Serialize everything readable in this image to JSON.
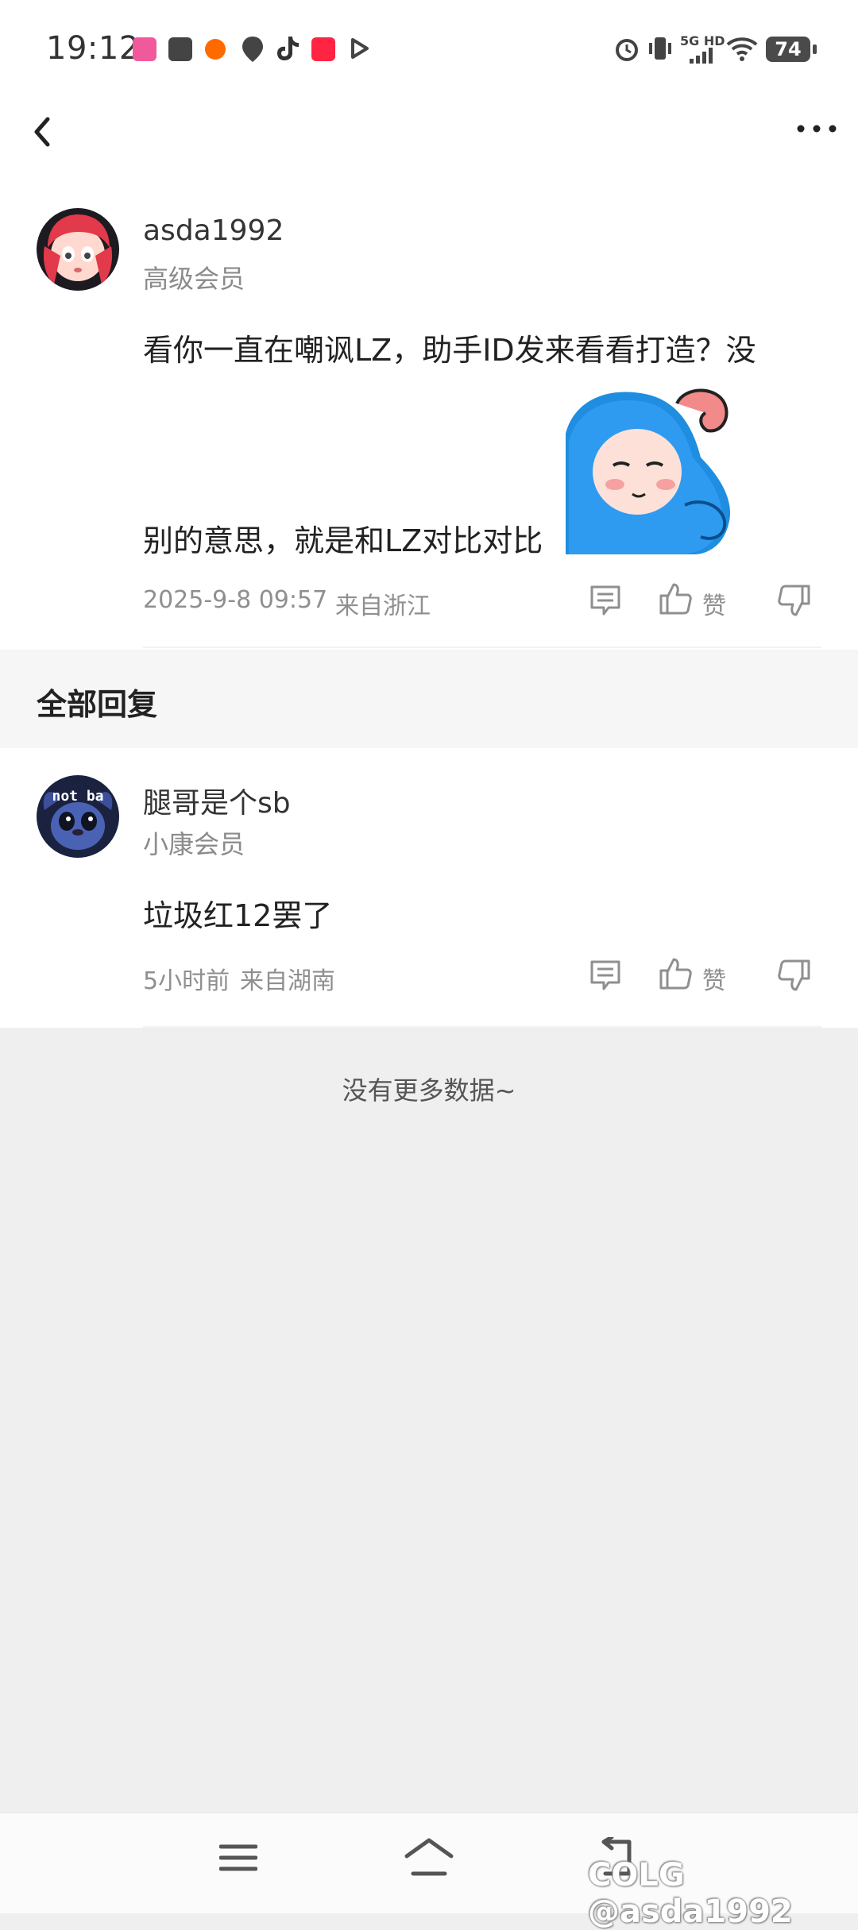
{
  "status_bar": {
    "time": "19:12",
    "network": "5G HD",
    "battery": "74",
    "app_icons": [
      "lofter-icon",
      "mail-icon",
      "taobao-icon",
      "du-icon",
      "tiktok-icon",
      "xiaohongshu-icon",
      "play-icon"
    ]
  },
  "top_bar": {
    "back_icon": "chevron-left-icon",
    "more_icon": "more-dots-icon"
  },
  "post": {
    "username": "asda1992",
    "member_level": "高级会员",
    "content_line1": "看你一直在嘲讽LZ，助手ID发来看看打造？没",
    "content_line2": "别的意思，就是和LZ对比对比",
    "sticker": "blue-character-sticker",
    "timestamp": "2025-9-8 09:57",
    "location": "来自浙江",
    "like_label": "赞"
  },
  "section": {
    "title": "全部回复"
  },
  "reply": {
    "username": "腿哥是个sb",
    "member_level": "小康会员",
    "content": "垃圾红12罢了",
    "timestamp": "5小时前",
    "location": "来自湖南",
    "like_label": "赞"
  },
  "footer": {
    "no_more": "没有更多数据~"
  },
  "nav_bar": {
    "watermark": "COLG @asda1992"
  }
}
